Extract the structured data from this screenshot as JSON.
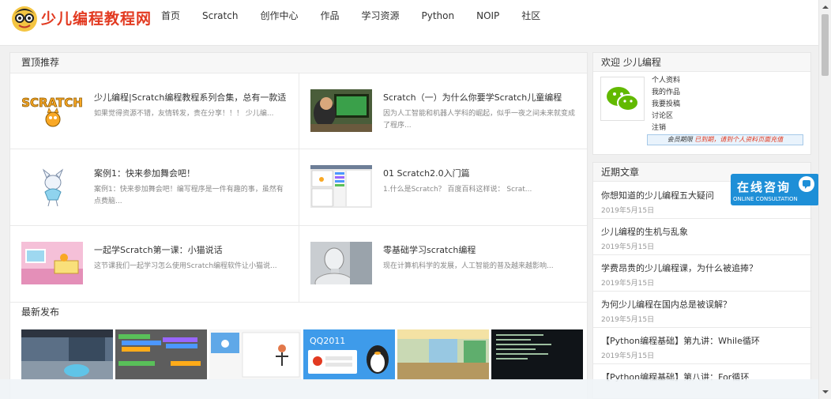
{
  "header": {
    "logo_text": "少儿编程教程网",
    "nav": [
      "首页",
      "Scratch",
      "创作中心",
      "作品",
      "学习资源",
      "Python",
      "NOIP",
      "社区"
    ]
  },
  "pinned": {
    "title": "置顶推荐",
    "items": [
      {
        "title": "少儿编程|Scratch编程教程系列合集，总有一款适",
        "desc": "如果觉得资源不错，友情转发，贵在分享！！！ 少儿编..."
      },
      {
        "title": "Scratch（一）为什么你要学Scratch儿童编程",
        "desc": "因为人工智能和机器人学科的崛起，似乎一夜之间未来就变成了程序..."
      },
      {
        "title": "案例1：快来参加舞会吧！",
        "desc": "案例1：快来参加舞会吧！编写程序是一件有趣的事，虽然有点费脑..."
      },
      {
        "title": "01 Scratch2.0入门篇",
        "desc": "1.什么是Scratch？ 百度百科这样说： Scrat..."
      },
      {
        "title": "一起学Scratch第一课：小猫说话",
        "desc": "这节课我们一起学习怎么使用Scratch编程软件让小猫说..."
      },
      {
        "title": "零基础学习scratch编程",
        "desc": "现在计算机科学的发展，人工智能的普及越来越影响..."
      }
    ]
  },
  "latest": {
    "title": "最新发布",
    "thumb_text": "QQ2011"
  },
  "welcome": {
    "title": "欢迎 少儿编程",
    "links": [
      "个人资料",
      "我的作品",
      "我要投稿",
      "讨论区",
      "注销"
    ],
    "member_label": "会员期限",
    "member_warning": "已到期，请到个人资料页面充值"
  },
  "recent": {
    "title": "近期文章",
    "items": [
      {
        "title": "你想知道的少儿编程五大疑问",
        "date": "2019年5月15日"
      },
      {
        "title": "少儿编程的生机与乱象",
        "date": "2019年5月15日"
      },
      {
        "title": "学费昂贵的少儿编程课，为什么被追捧？",
        "date": "2019年5月15日"
      },
      {
        "title": "为何少儿编程在国内总是被误解？",
        "date": "2019年5月15日"
      },
      {
        "title": "【Python编程基础】第九讲：While循环",
        "date": "2019年5月15日"
      },
      {
        "title": "【Python编程基础】第八讲：For循环",
        "date": ""
      }
    ]
  },
  "consult": {
    "title": "在线咨询",
    "subtitle": "ONLINE CONSULTATION"
  }
}
